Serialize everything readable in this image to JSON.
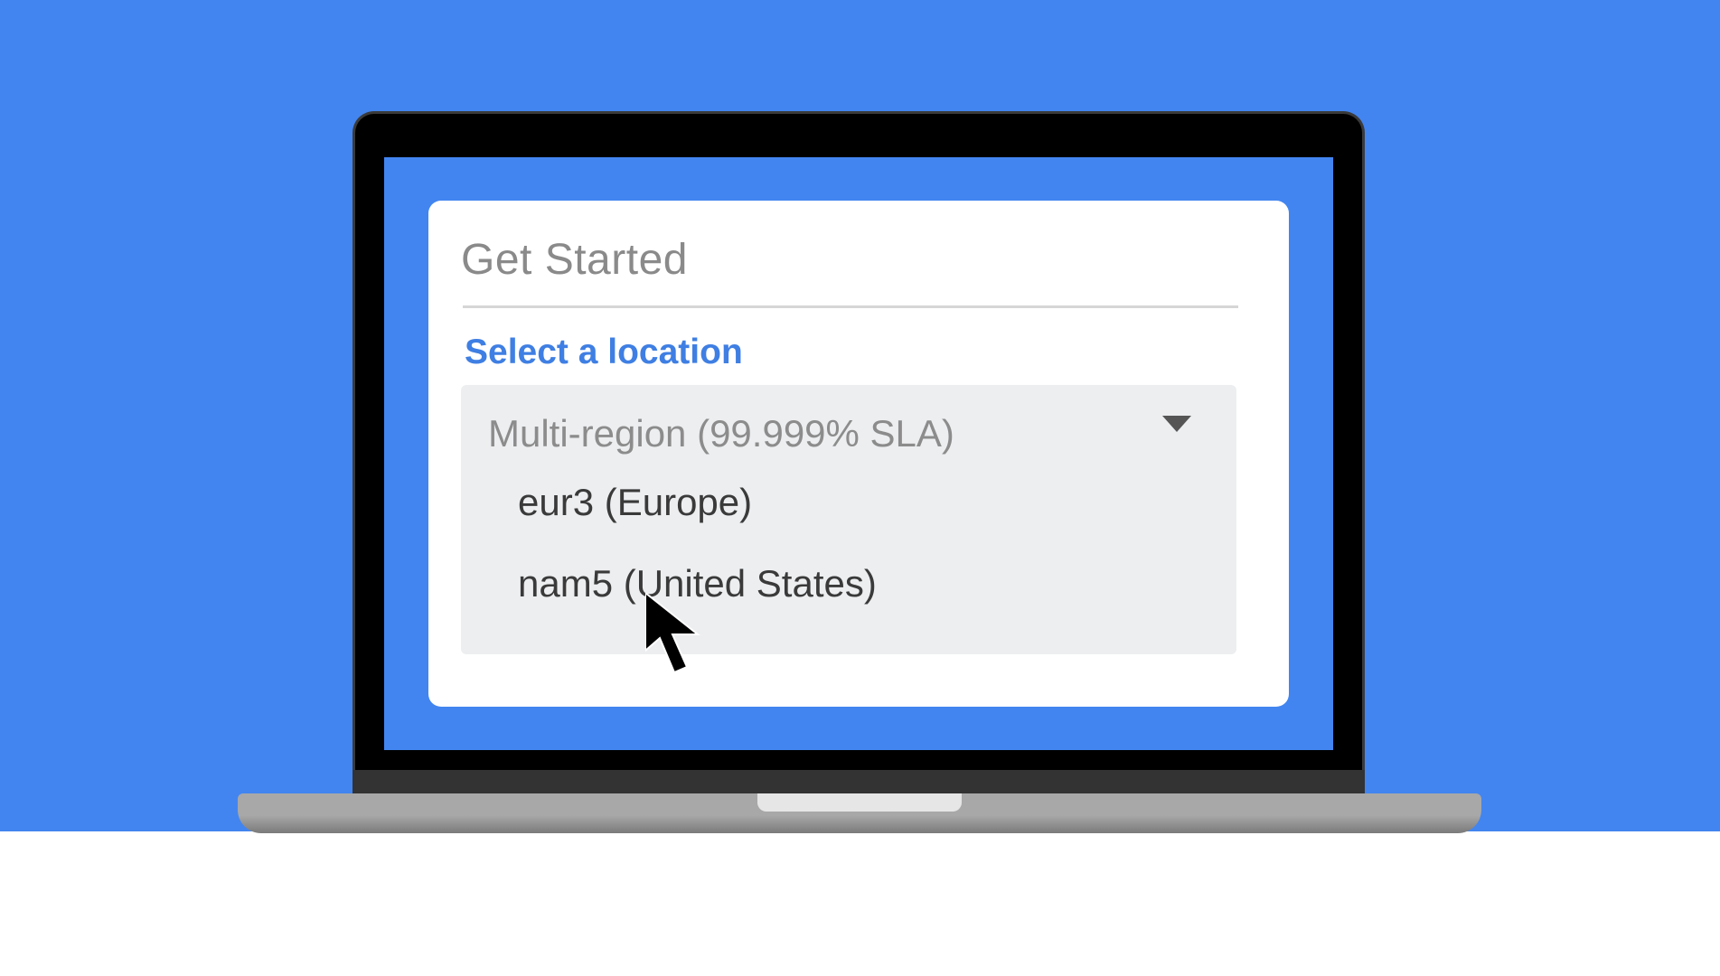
{
  "dialog": {
    "title": "Get Started",
    "section_label": "Select a location"
  },
  "location_dropdown": {
    "selected_value": "Multi-region (99.999% SLA)",
    "icon": "caret-down-icon",
    "options": [
      {
        "label": "eur3 (Europe)"
      },
      {
        "label": "nam5 (United States)"
      }
    ]
  },
  "colors": {
    "background_blue": "#4285f0",
    "section_label_blue": "#3f7fe3",
    "dropdown_bg": "#eceef0"
  }
}
